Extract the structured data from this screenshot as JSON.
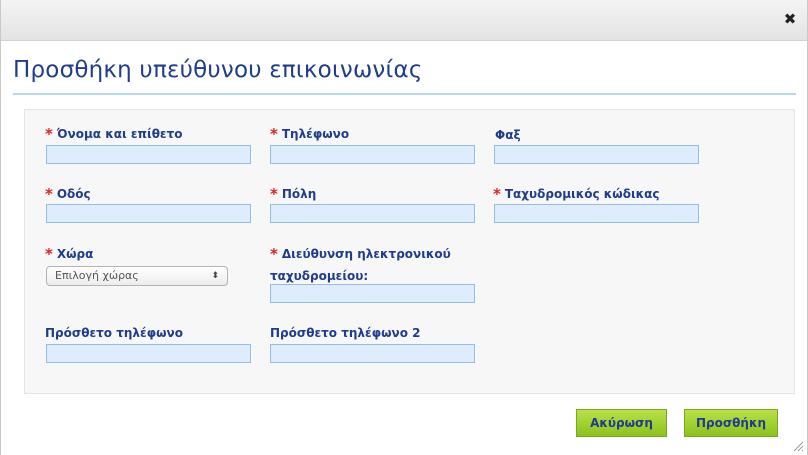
{
  "dialog": {
    "title": "Προσθήκη υπεύθυνου επικοινωνίας",
    "close_symbol": "✖"
  },
  "form": {
    "name": {
      "label": "Όνομα και επίθετο",
      "required": true,
      "value": ""
    },
    "phone": {
      "label": "Τηλέφωνο",
      "required": true,
      "value": ""
    },
    "fax": {
      "label": "Φαξ",
      "required": false,
      "value": ""
    },
    "street": {
      "label": "Οδός",
      "required": true,
      "value": ""
    },
    "city": {
      "label": "Πόλη",
      "required": true,
      "value": ""
    },
    "postal_code": {
      "label": "Ταχυδρομικός κώδικας",
      "required": true,
      "value": ""
    },
    "country": {
      "label": "Χώρα",
      "required": true,
      "selected": "Επιλογή χώρας"
    },
    "email": {
      "label_line1": "Διεύθυνση ηλεκτρονικού",
      "label_line2": "ταχυδρομείου:",
      "required": true,
      "value": ""
    },
    "extra_phone": {
      "label": "Πρόσθετο τηλέφωνο",
      "required": false,
      "value": ""
    },
    "extra_phone_2": {
      "label": "Πρόσθετο τηλέφωνο 2",
      "required": false,
      "value": ""
    },
    "required_marker": "*"
  },
  "buttons": {
    "cancel": "Ακύρωση",
    "add": "Προσθήκη"
  },
  "colors": {
    "title": "#1f3d8c",
    "required": "#e02020",
    "input_bg": "#deecfb",
    "button_green": "#9acd32"
  },
  "icons": {
    "close": "close-icon",
    "select_arrows": "updown-arrows-icon",
    "resize": "resize-grip-icon"
  }
}
